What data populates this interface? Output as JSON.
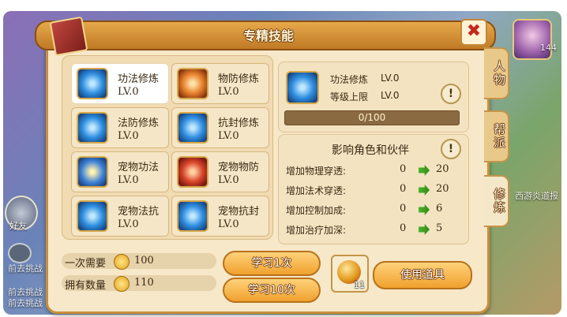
{
  "dialog": {
    "title": "专精技能",
    "close_label": "✖"
  },
  "side_tabs": [
    "人物",
    "帮派",
    "修炼"
  ],
  "background": {
    "friend_label": "好友",
    "hints": [
      "前去挑战",
      "前去挑战",
      "前去挑战",
      "西游炎道报"
    ],
    "badge": "144"
  },
  "skills": [
    {
      "name": "功法修炼",
      "level": "LV.0",
      "icon": "skill-orb-icon",
      "selected": true
    },
    {
      "name": "物防修炼",
      "level": "LV.0",
      "icon": "armor-orb-icon",
      "selected": false
    },
    {
      "name": "法防修炼",
      "level": "LV.0",
      "icon": "magic-shield-icon",
      "selected": false
    },
    {
      "name": "抗封修炼",
      "level": "LV.0",
      "icon": "seal-resist-icon",
      "selected": false
    },
    {
      "name": "宠物功法",
      "level": "LV.0",
      "icon": "pet-skill-icon",
      "selected": false
    },
    {
      "name": "宠物物防",
      "level": "LV.0",
      "icon": "pet-armor-icon",
      "selected": false
    },
    {
      "name": "宠物法抗",
      "level": "LV.0",
      "icon": "pet-magic-resist-icon",
      "selected": false
    },
    {
      "name": "宠物抗封",
      "level": "LV.0",
      "icon": "pet-seal-resist-icon",
      "selected": false
    }
  ],
  "detail": {
    "name": "功法修炼",
    "level": "LV.0",
    "limit_label": "等级上限",
    "limit_value": "LV.0",
    "progress_text": "0/100",
    "progress": 0,
    "info_label": "!"
  },
  "effects": {
    "title": "影响角色和伙伴",
    "info_label": "!",
    "rows": [
      {
        "label": "增加物理穿透:",
        "from": "0",
        "to": "20"
      },
      {
        "label": "增加法术穿透:",
        "from": "0",
        "to": "20"
      },
      {
        "label": "增加控制加成:",
        "from": "0",
        "to": "6"
      },
      {
        "label": "增加治疗加深:",
        "from": "0",
        "to": "5"
      }
    ]
  },
  "cost": {
    "need_label": "一次需要",
    "need_value": "100",
    "own_label": "拥有数量",
    "own_value": "110"
  },
  "buttons": {
    "learn_once": "学习1次",
    "learn_ten": "学习10次",
    "use_item": "使用道具"
  },
  "item": {
    "count": "11",
    "icon": "treasure-chest-icon"
  },
  "colors": {
    "accent": "#c88f3d",
    "button": "#f0a12e",
    "arrow": "#4fb52b",
    "close": "#c5281c"
  }
}
